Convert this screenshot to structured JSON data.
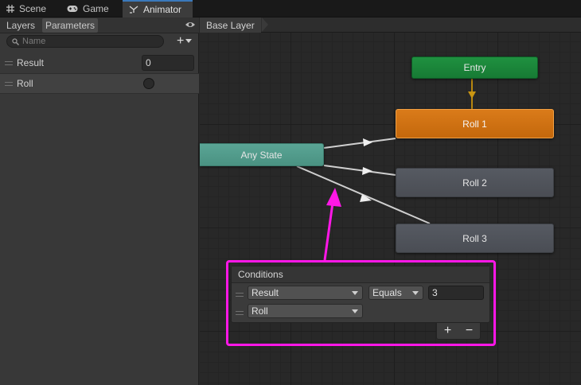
{
  "tabs": [
    {
      "label": "Scene",
      "icon": "grid-icon"
    },
    {
      "label": "Game",
      "icon": "gamepad-icon"
    },
    {
      "label": "Animator",
      "icon": "animator-icon",
      "active": true
    }
  ],
  "left_panel": {
    "subtabs": [
      {
        "label": "Layers"
      },
      {
        "label": "Parameters",
        "active": true
      }
    ],
    "search": {
      "placeholder": "Name",
      "value": ""
    },
    "add_symbol": "+",
    "parameters": [
      {
        "name": "Result",
        "type": "int",
        "value": "0"
      },
      {
        "name": "Roll",
        "type": "trigger",
        "selected": true
      }
    ]
  },
  "graph": {
    "breadcrumb": "Base Layer",
    "states": {
      "entry": "Entry",
      "roll1": "Roll 1",
      "roll2": "Roll 2",
      "roll3": "Roll 3",
      "any_state": "Any State"
    }
  },
  "conditions": {
    "title": "Conditions",
    "rows": [
      {
        "parameter": "Result",
        "mode": "Equals",
        "value": "3"
      },
      {
        "parameter": "Roll"
      }
    ],
    "add_symbol": "+",
    "remove_symbol": "−"
  },
  "colors": {
    "entry": "#1f9140",
    "default_state": "#d97a1a",
    "state": "#51545b",
    "any_state": "#55a090",
    "highlight": "#ff17e7",
    "active_tab_accent": "#3a79bb"
  }
}
